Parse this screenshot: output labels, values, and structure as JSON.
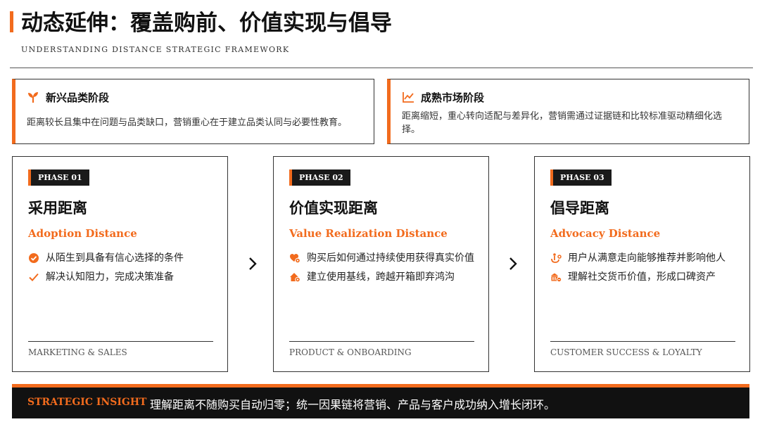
{
  "header": {
    "title": "动态延伸：覆盖购前、价值实现与倡导",
    "subtitle": "UNDERSTANDING DISTANCE STRATEGIC FRAMEWORK"
  },
  "stages": [
    {
      "icon": "sprout-icon",
      "title": "新兴品类阶段",
      "description": "距离较长且集中在问题与品类缺口，营销重心在于建立品类认同与必要性教育。"
    },
    {
      "icon": "line-chart-icon",
      "title": "成熟市场阶段",
      "description": "距离缩短，重心转向适配与差异化，营销需通过证据链和比较标准驱动精细化选择。"
    }
  ],
  "phases": [
    {
      "badge": "PHASE 01",
      "title": "采用距离",
      "subtitle": "Adoption Distance",
      "items": [
        {
          "icon": "check-circle-icon",
          "text": "从陌生到具备有信心选择的条件"
        },
        {
          "icon": "check-icon",
          "text": "解决认知阻力，完成决策准备"
        }
      ],
      "footer": "MARKETING & SALES"
    },
    {
      "badge": "PHASE 02",
      "title": "价值实现距离",
      "subtitle": "Value Realization Distance",
      "items": [
        {
          "icon": "heart-gear-icon",
          "text": "购买后如何通过持续使用获得真实价值"
        },
        {
          "icon": "house-gear-icon",
          "text": "建立使用基线，跨越开箱即弃鸿沟"
        }
      ],
      "footer": "PRODUCT & ONBOARDING"
    },
    {
      "badge": "PHASE 03",
      "title": "倡导距离",
      "subtitle": "Advocacy Distance",
      "items": [
        {
          "icon": "share-hand-icon",
          "text": "用户从满意走向能够推荐并影响他人"
        },
        {
          "icon": "bank-coins-icon",
          "text": "理解社交货币价值，形成口碑资产"
        }
      ],
      "footer": "CUSTOMER SUCCESS & LOYALTY"
    }
  ],
  "insight": {
    "label": "STRATEGIC INSIGHT",
    "text": "理解距离不随购买自动归零；统一因果链将营销、产品与客户成功纳入增长闭环。"
  },
  "colors": {
    "accent": "#f26b1d",
    "dark": "#111111"
  }
}
